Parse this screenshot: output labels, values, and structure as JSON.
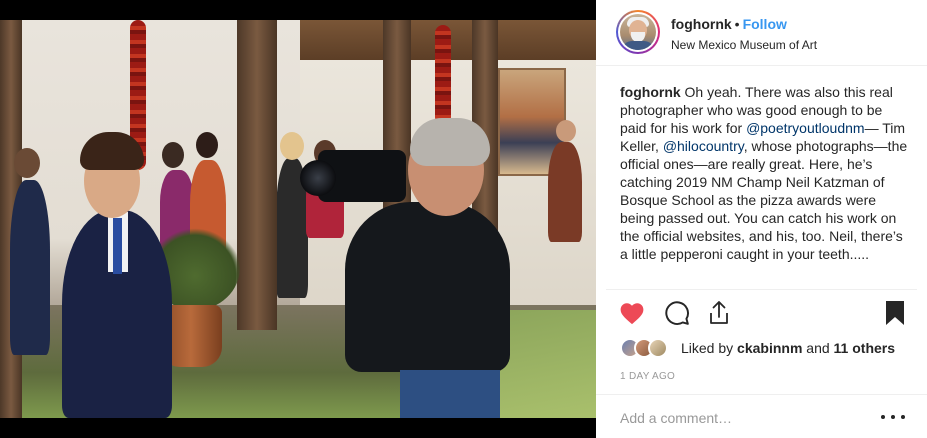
{
  "post": {
    "image_alt": "Photographer with camera photographing a young man in a suit in a museum courtyard",
    "image_description_visible": false
  },
  "header": {
    "username": "foghornk",
    "separator": "•",
    "follow_label": "Follow",
    "location": "New Mexico Museum of Art",
    "avatar_icon": "user-avatar-icon"
  },
  "caption": {
    "username": "foghornk",
    "text_1": " Oh yeah. There was also this real photographer who was good enough to be paid for his work for ",
    "mention_1": "@poetryoutloudnm",
    "text_2": "— Tim Keller, ",
    "mention_2": "@hilocountry",
    "text_3": ", whose photographs—the official ones—are really great. Here, he’s catching 2019 NM Champ Neil Katzman of Bosque School as the pizza awards were being passed out. You can catch his work on the official websites, and his, too. Neil, there’s a little pepperoni caught in your teeth....."
  },
  "actions": {
    "like_icon": "heart-icon",
    "comment_icon": "comment-bubble-icon",
    "share_icon": "share-icon",
    "save_icon": "bookmark-icon",
    "like_color": "#ed4956"
  },
  "likes": {
    "prefix": "Liked by ",
    "first_liker": "ckabinnm",
    "joiner": " and ",
    "others": "11 others"
  },
  "timestamp": "1 DAY AGO",
  "comment_box": {
    "placeholder": "Add a comment…",
    "value": "",
    "more_icon": "more-options-icon"
  },
  "colors": {
    "accent": "#3897f0",
    "text": "#262626",
    "muted": "#999999",
    "border": "#efefef"
  }
}
